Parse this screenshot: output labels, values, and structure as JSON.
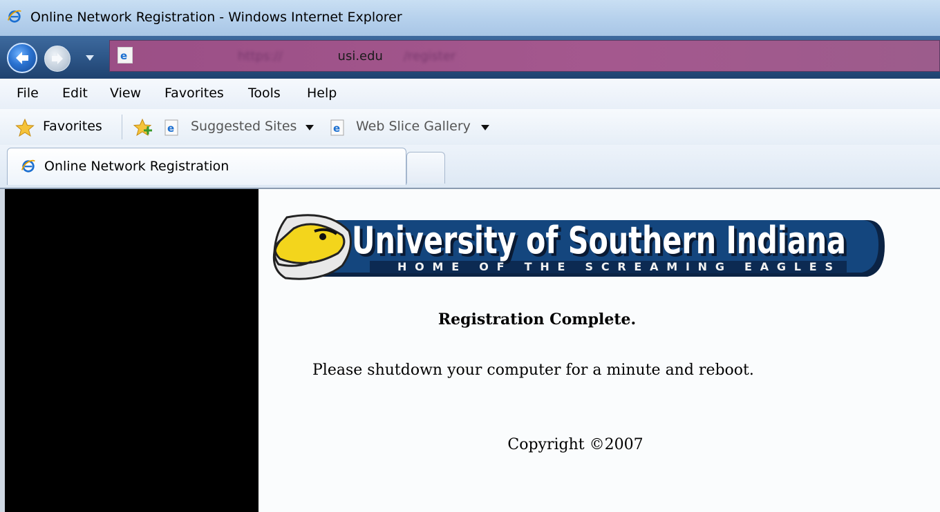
{
  "window": {
    "title": "Online Network Registration - Windows Internet Explorer"
  },
  "address_bar": {
    "url_prefix": "https://",
    "url_domain": "usi.edu",
    "url_path": "/register",
    "url_color": "#a4588e"
  },
  "menu": {
    "items": [
      "File",
      "Edit",
      "View",
      "Favorites",
      "Tools",
      "Help"
    ]
  },
  "favorites_bar": {
    "favorites_label": "Favorites",
    "links": [
      {
        "label": "Suggested Sites",
        "icon": "ie-page-icon"
      },
      {
        "label": "Web Slice Gallery",
        "icon": "ie-page-icon"
      }
    ]
  },
  "tabs": {
    "active_label": "Online Network Registration"
  },
  "page": {
    "banner_title": "University of Southern Indiana",
    "banner_subtitle": "HOME OF THE SCREAMING EAGLES",
    "heading": "Registration Complete.",
    "message": "Please shutdown your computer for a minute and reboot.",
    "copyright": "Copyright ©2007",
    "colors": {
      "banner_blue": "#14467e",
      "banner_yellow": "#f3d51c",
      "left_panel": "#000000"
    }
  }
}
